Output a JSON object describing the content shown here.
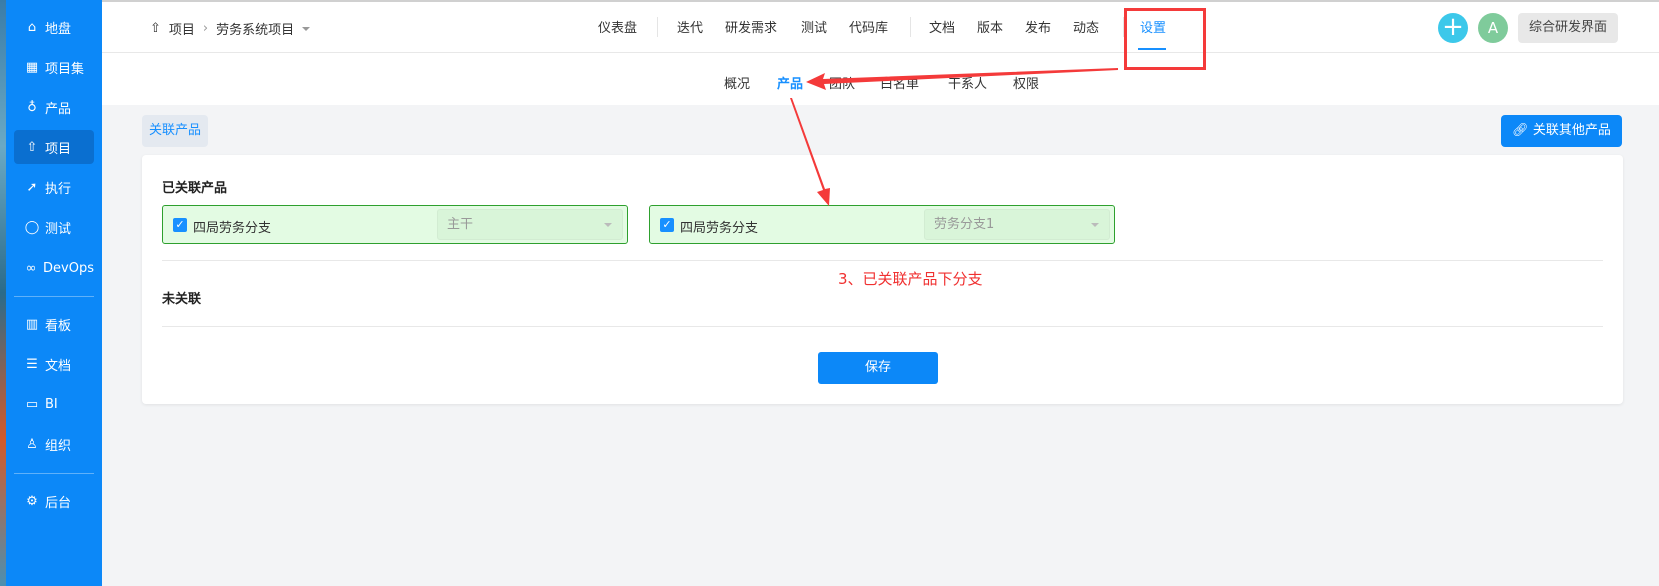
{
  "sidebar": {
    "items": [
      {
        "label": "地盘",
        "icon": "home-icon"
      },
      {
        "label": "项目集",
        "icon": "grid-icon"
      },
      {
        "label": "产品",
        "icon": "bulb-icon"
      },
      {
        "label": "项目",
        "icon": "rocket-icon",
        "active": true
      },
      {
        "label": "执行",
        "icon": "run-icon"
      },
      {
        "label": "测试",
        "icon": "search-icon"
      },
      {
        "label": "DevOps",
        "icon": "infinity-icon"
      },
      {
        "label": "看板",
        "icon": "board-icon"
      },
      {
        "label": "文档",
        "icon": "doc-icon"
      },
      {
        "label": "BI",
        "icon": "monitor-icon"
      },
      {
        "label": "组织",
        "icon": "users-icon"
      },
      {
        "label": "后台",
        "icon": "gear-icon"
      }
    ]
  },
  "header": {
    "breadcrumb": {
      "root": "项目",
      "current": "劳务系统项目"
    },
    "nav": [
      "仪表盘",
      "迭代",
      "研发需求",
      "测试",
      "代码库",
      "文档",
      "版本",
      "发布",
      "动态",
      "设置"
    ],
    "active_nav": "设置",
    "avatar": "A",
    "workspace": "综合研发界面"
  },
  "subnav": {
    "tabs": [
      "概况",
      "产品",
      "团队",
      "白名单",
      "干系人",
      "权限"
    ],
    "active": "产品"
  },
  "main": {
    "tag": "关联产品",
    "link_button": "关联其他产品",
    "linked_title": "已关联产品",
    "linked": [
      {
        "name": "四局劳务分支",
        "branch": "主干",
        "checked": true
      },
      {
        "name": "四局劳务分支",
        "branch": "劳务分支1",
        "checked": true
      }
    ],
    "unlinked_title": "未关联",
    "save": "保存"
  },
  "annotation": {
    "text": "3、已关联产品下分支",
    "color": "#f03030"
  }
}
